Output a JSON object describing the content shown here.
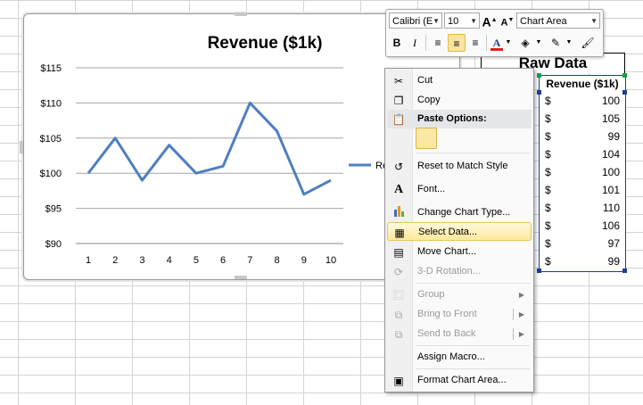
{
  "chart": {
    "title": "Revenue ($1k)",
    "legend_label": "Re"
  },
  "chart_data": {
    "type": "line",
    "title": "Revenue ($1k)",
    "x": [
      1,
      2,
      3,
      4,
      5,
      6,
      7,
      8,
      9,
      10
    ],
    "series": [
      {
        "name": "Re",
        "values": [
          100,
          105,
          99,
          104,
          100,
          101,
          110,
          106,
          97,
          99
        ]
      }
    ],
    "ylim": [
      90,
      115
    ],
    "yticks": [
      "$90",
      "$95",
      "$100",
      "$105",
      "$110",
      "$115"
    ],
    "xticks": [
      "1",
      "2",
      "3",
      "4",
      "5",
      "6",
      "7",
      "8",
      "9",
      "10"
    ],
    "line_color": "#4f7fbf",
    "grid": true,
    "legend_position": "right"
  },
  "raw": {
    "title": "Raw Data",
    "header": "Revenue ($1k)",
    "currency": "$",
    "values": [
      "100",
      "105",
      "99",
      "104",
      "100",
      "101",
      "110",
      "106",
      "97",
      "99"
    ]
  },
  "toolbar": {
    "font": "Calibri (E",
    "size": "10",
    "grow": "A",
    "shrink": "A",
    "element": "Chart Area",
    "bold": "B",
    "italic": "I",
    "font_color_letter": "A"
  },
  "menu": {
    "items": [
      {
        "label": "Cut",
        "icon": "scissors-icon"
      },
      {
        "label": "Copy",
        "icon": "copy-icon"
      },
      {
        "label": "Paste Options:",
        "icon": "paste-icon"
      },
      {
        "label": "Reset to Match Style",
        "icon": "reset-style-icon"
      },
      {
        "label": "Font...",
        "icon": "font-icon"
      },
      {
        "label": "Change Chart Type...",
        "icon": "chart-type-icon"
      },
      {
        "label": "Select Data...",
        "icon": "select-data-icon"
      },
      {
        "label": "Move Chart...",
        "icon": "move-chart-icon"
      },
      {
        "label": "3-D Rotation...",
        "icon": "rotation-icon"
      },
      {
        "label": "Group",
        "icon": "group-icon"
      },
      {
        "label": "Bring to Front",
        "icon": "bring-front-icon"
      },
      {
        "label": "Send to Back",
        "icon": "send-back-icon"
      },
      {
        "label": "Assign Macro...",
        "icon": ""
      },
      {
        "label": "Format Chart Area...",
        "icon": "format-area-icon"
      }
    ]
  }
}
